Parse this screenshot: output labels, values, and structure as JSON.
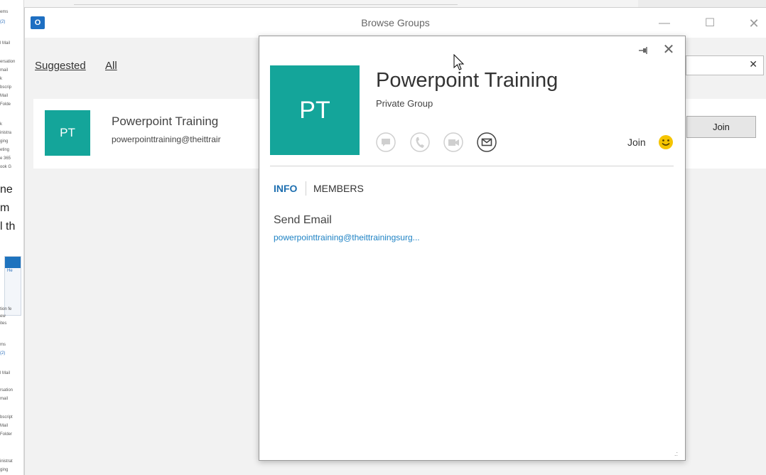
{
  "background_window": {
    "visible_fragments": [
      "ems",
      "(2)",
      "l Mail",
      "ersation",
      "mail",
      "k",
      "bscrip",
      "Mail",
      "Folde",
      "k",
      "inistra",
      "ging",
      "eting",
      "e 365",
      "ook G",
      "ne",
      "m",
      "l th",
      "He",
      "tion fe",
      "ew",
      "ites",
      "ms",
      "(2)",
      "l Mail",
      "rsation",
      "mail",
      "bscript",
      "Mail",
      "Folder",
      "inistrat",
      "ging"
    ]
  },
  "window": {
    "title": "Browse Groups",
    "app_logo": "O",
    "minimize_glyph": "—",
    "maximize_glyph": "☐",
    "close_glyph": "✕"
  },
  "nav": {
    "suggested": "Suggested",
    "all": "All"
  },
  "search": {
    "clear_glyph": "✕"
  },
  "group_card": {
    "initials": "PT",
    "name": "Powerpoint Training",
    "email": "powerpointtraining@theittrair",
    "join_label": "Join"
  },
  "popup": {
    "initials": "PT",
    "name": "Powerpoint Training",
    "type": "Private Group",
    "join_label": "Join",
    "close_glyph": "✕",
    "tabs": {
      "info": "INFO",
      "members": "MEMBERS"
    },
    "send_email_label": "Send Email",
    "send_email_address": "powerpointtraining@theittrainingsurg...",
    "grip": ".:"
  },
  "colors": {
    "group_avatar": "#14a59a",
    "link_blue": "#1e82c4",
    "tab_active": "#1e6fb0",
    "smiley": "#f5c400"
  }
}
